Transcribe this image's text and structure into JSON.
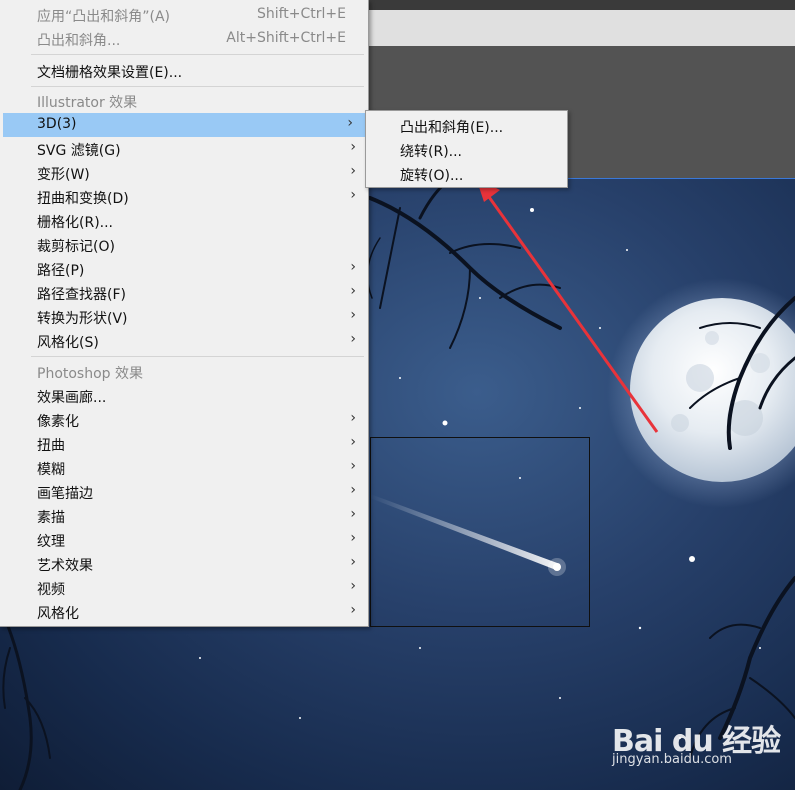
{
  "menu": {
    "items": [
      {
        "label": "应用“凸出和斜角”(A)",
        "shortcut": "Shift+Ctrl+E"
      },
      {
        "label": "凸出和斜角...",
        "shortcut": "Alt+Shift+Ctrl+E"
      },
      {
        "label": "文档栅格效果设置(E)..."
      }
    ],
    "illustrator_header": "Illustrator 效果",
    "illustrator_items": [
      {
        "label": "3D(3)"
      },
      {
        "label": "SVG 滤镜(G)"
      },
      {
        "label": "变形(W)"
      },
      {
        "label": "扭曲和变换(D)"
      },
      {
        "label": "栅格化(R)..."
      },
      {
        "label": "裁剪标记(O)"
      },
      {
        "label": "路径(P)"
      },
      {
        "label": "路径查找器(F)"
      },
      {
        "label": "转换为形状(V)"
      },
      {
        "label": "风格化(S)"
      }
    ],
    "photoshop_header": "Photoshop 效果",
    "photoshop_items": [
      {
        "label": "效果画廊..."
      },
      {
        "label": "像素化"
      },
      {
        "label": "扭曲"
      },
      {
        "label": "模糊"
      },
      {
        "label": "画笔描边"
      },
      {
        "label": "素描"
      },
      {
        "label": "纹理"
      },
      {
        "label": "艺术效果"
      },
      {
        "label": "视频"
      },
      {
        "label": "风格化"
      }
    ],
    "arrow": "›"
  },
  "submenu_3d": {
    "items": [
      {
        "label": "凸出和斜角(E)..."
      },
      {
        "label": "绕转(R)..."
      },
      {
        "label": "旋转(O)..."
      }
    ]
  },
  "annotation": {
    "color": "#e8333a"
  },
  "watermark": {
    "logo": "Bai du 经验",
    "url": "jingyan.baidu.com"
  },
  "colors": {
    "menu_bg": "#f0f0f0",
    "highlight": "#99c9f5"
  }
}
